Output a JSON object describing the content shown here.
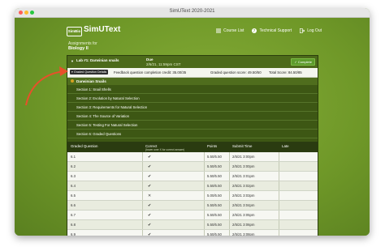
{
  "window": {
    "title": "SimUText 2020-2021"
  },
  "header": {
    "logo_badge": "SimBio",
    "logo_text": "SimUText",
    "links": [
      {
        "label": "Course List",
        "icon": "list-icon"
      },
      {
        "label": "Technical Support",
        "icon": "question-icon"
      },
      {
        "label": "Log Out",
        "icon": "logout-icon"
      }
    ]
  },
  "page": {
    "subtitle": "Assignments for",
    "course": "Biology II"
  },
  "lab": {
    "name": "Lab #1: Darwinian snails",
    "due_label": "Due",
    "due_value": "2/6/21, 11:59pm CST",
    "status": "✓ Complete"
  },
  "details": {
    "button": "Graded Question Details",
    "feedback": "Feedback question completion credit: 35.00/35",
    "graded": "Graded question score: 49.50/50",
    "total": "Total Score: 84.50/85"
  },
  "topic": "Darwinian Snails",
  "sections": [
    "Section 1: Snail Shells",
    "Section 2: Evolution by Natural Selection",
    "Section 3: Requirements for Natural Selection",
    "Section 4: The Source of Variation",
    "Section 5: Testing For Natural Selection",
    "Section 6: Graded Questions"
  ],
  "table": {
    "headers": {
      "question": "Graded Question",
      "correct": "Correct",
      "correct_sub": "(hover over X for correct answer)",
      "points": "Points",
      "submit": "Submit Time",
      "late": "Late"
    },
    "rows": [
      {
        "q": "6.1",
        "c": "✔",
        "p": "5.50/5.50",
        "t": "2/5/21 3:00pm",
        "l": ""
      },
      {
        "q": "6.2",
        "c": "✔",
        "p": "5.50/5.50",
        "t": "2/5/21 3:00pm",
        "l": ""
      },
      {
        "q": "6.3",
        "c": "✔",
        "p": "5.50/5.50",
        "t": "2/5/21 3:01pm",
        "l": ""
      },
      {
        "q": "6.4",
        "c": "✔",
        "p": "5.50/5.50",
        "t": "2/5/21 3:02pm",
        "l": ""
      },
      {
        "q": "6.5",
        "c": "✕",
        "p": "5.00/5.50",
        "t": "2/5/21 3:03pm",
        "l": ""
      },
      {
        "q": "6.6",
        "c": "✔",
        "p": "5.50/5.50",
        "t": "2/5/21 3:04pm",
        "l": ""
      },
      {
        "q": "6.7",
        "c": "✔",
        "p": "5.50/5.50",
        "t": "2/5/21 3:05pm",
        "l": ""
      },
      {
        "q": "6.8",
        "c": "✔",
        "p": "5.50/5.50",
        "t": "2/5/21 3:06pm",
        "l": ""
      },
      {
        "q": "6.9",
        "c": "✔",
        "p": "5.50/5.50",
        "t": "2/5/21 3:08pm",
        "l": ""
      },
      {
        "q": "6.10",
        "c": "✔",
        "p": "5.50/5.50",
        "t": "2/5/21 3:09pm",
        "l": ""
      }
    ]
  },
  "colors": {
    "accent_green": "#6f9a2a",
    "annotation_arrow": "#e8502a"
  }
}
